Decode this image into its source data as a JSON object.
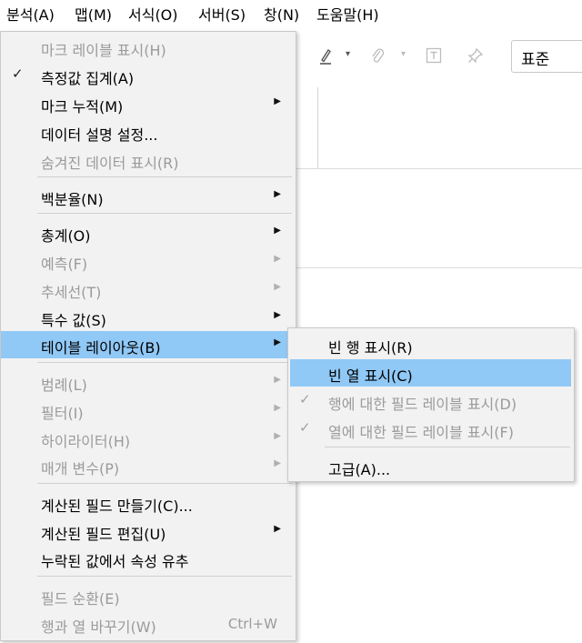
{
  "menubar": {
    "items": [
      {
        "label": "분석(A)"
      },
      {
        "label": "맵(M)"
      },
      {
        "label": "서식(O)"
      },
      {
        "label": "서버(S)"
      },
      {
        "label": "창(N)"
      },
      {
        "label": "도움말(H)"
      }
    ]
  },
  "toolbar": {
    "format_dropdown_value": "표준",
    "icons": [
      "pen-icon",
      "paperclip-icon",
      "text-box-icon",
      "pin-icon"
    ]
  },
  "analysis_menu": {
    "items": [
      {
        "label": "마크 레이블 표시(H)",
        "disabled": true
      },
      {
        "label": "측정값 집계(A)",
        "checked": true
      },
      {
        "label": "마크 누적(M)",
        "submenu": true
      },
      {
        "label": "데이터 설명 설정..."
      },
      {
        "label": "숨겨진 데이터 표시(R)",
        "disabled": true
      },
      {
        "label": "백분율(N)",
        "submenu": true
      },
      {
        "label": "총계(O)",
        "submenu": true
      },
      {
        "label": "예측(F)",
        "disabled": true,
        "submenu": true
      },
      {
        "label": "추세선(T)",
        "disabled": true,
        "submenu": true
      },
      {
        "label": "특수 값(S)",
        "submenu": true
      },
      {
        "label": "테이블 레이아웃(B)",
        "submenu": true,
        "selected": true
      },
      {
        "label": "범례(L)",
        "disabled": true,
        "submenu": true
      },
      {
        "label": "필터(I)",
        "disabled": true,
        "submenu": true
      },
      {
        "label": "하이라이터(H)",
        "disabled": true,
        "submenu": true
      },
      {
        "label": "매개 변수(P)",
        "disabled": true,
        "submenu": true
      },
      {
        "label": "계산된 필드 만들기(C)..."
      },
      {
        "label": "계산된 필드 편집(U)",
        "submenu": true
      },
      {
        "label": "누락된 값에서 속성 유추"
      },
      {
        "label": "필드 순환(E)",
        "disabled": true
      },
      {
        "label": "행과 열 바꾸기(W)",
        "disabled": true,
        "shortcut": "Ctrl+W"
      }
    ]
  },
  "table_layout_submenu": {
    "items": [
      {
        "label": "빈 행 표시(R)"
      },
      {
        "label": "빈 열 표시(C)",
        "selected": true
      },
      {
        "label": "행에 대한 필드 레이블 표시(D)",
        "disabled": true,
        "checked": true
      },
      {
        "label": "열에 대한 필드 레이블 표시(F)",
        "disabled": true,
        "checked": true
      },
      {
        "label": "고급(A)..."
      }
    ]
  },
  "colors": {
    "menu_background": "#f2f2f2",
    "highlight": "#90c8f6",
    "disabled_text": "#9b9b9b"
  }
}
